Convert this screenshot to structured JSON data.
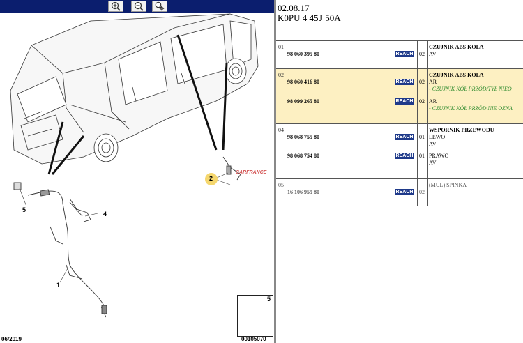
{
  "toolbar": {
    "buttons": [
      {
        "name": "zoom-in-icon",
        "label": "zoom in"
      },
      {
        "name": "zoom-out-icon",
        "label": "zoom out"
      },
      {
        "name": "zoom-pan-icon",
        "label": "zoom pan"
      }
    ]
  },
  "diagram": {
    "callouts": [
      "5",
      "4",
      "1",
      "2"
    ],
    "watermark": "CARFRANCE",
    "inset_number": "5",
    "date": "06/2019",
    "ref": "00105070",
    "colors": {
      "toolbar": "#0b1e6e",
      "callout_highlight": "#f5d76e"
    }
  },
  "header": {
    "date": "02.08.17",
    "code_prefix": "K0PU 4 ",
    "code_bold": "45J",
    "code_suffix": " 50A"
  },
  "groups": [
    {
      "num": "01",
      "rows": [
        {
          "part": "98 060 395 80",
          "reach": "REACH",
          "qty": "02",
          "desc": [
            "CZUJNIK ABS KOLA",
            "AV"
          ]
        }
      ]
    },
    {
      "num": "02",
      "selected": true,
      "rows": [
        {
          "part": "98 060 416 80",
          "reach": "REACH",
          "qty": "02",
          "desc": [
            "CZUJNIK ABS KOLA",
            "AR"
          ],
          "note": "- CZUJNIK KÓŁ PRZÓD/TYŁ NIEO"
        },
        {
          "part": "98 099 265 80",
          "reach": "REACH",
          "qty": "02",
          "desc": [
            "AR"
          ],
          "note": "- CZUJNIK KÓŁ PRZÓD NIE OZNA"
        }
      ]
    },
    {
      "num": "04",
      "rows": [
        {
          "part": "98 068 755 80",
          "reach": "REACH",
          "qty": "01",
          "desc": [
            "WSPORNIK PRZEWODU",
            "LEWO",
            "AV"
          ]
        },
        {
          "part": "98 068 754 80",
          "reach": "REACH",
          "qty": "01",
          "desc": [
            "PRAWO",
            "AV"
          ]
        }
      ]
    },
    {
      "num": "05",
      "dim": true,
      "rows": [
        {
          "part": "16 106 959 80",
          "reach": "REACH",
          "qty": "02",
          "desc": [
            "(MUL) SPINKA"
          ]
        }
      ]
    }
  ]
}
